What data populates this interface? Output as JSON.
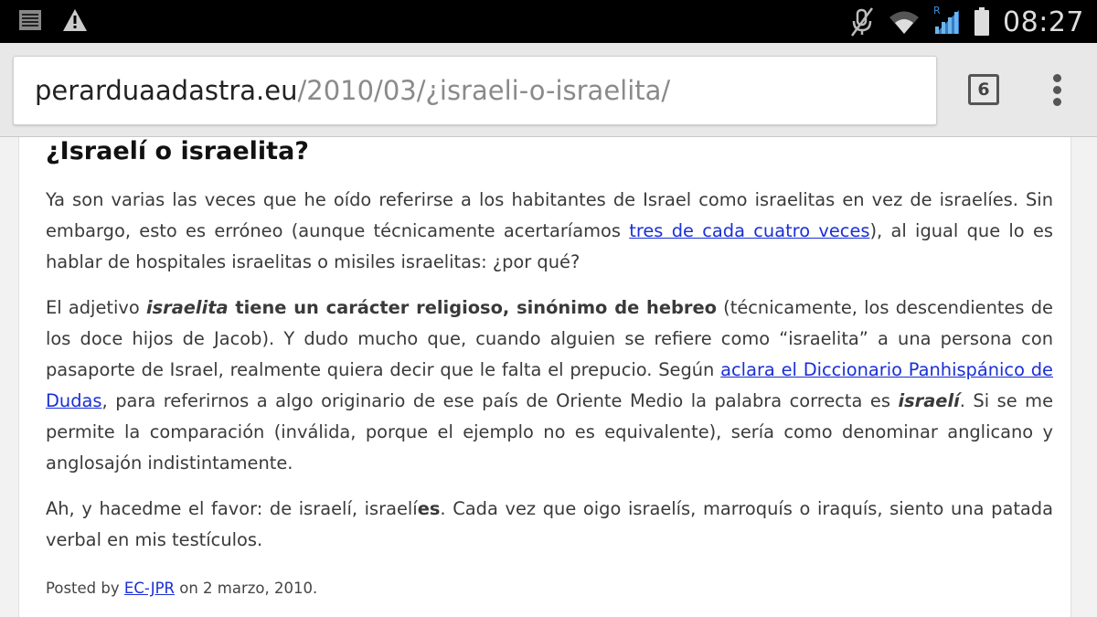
{
  "statusbar": {
    "time": "08:27",
    "icons": [
      "notification-list-icon",
      "warning-icon",
      "mute-icon",
      "wifi-icon",
      "signal-icon",
      "battery-icon"
    ],
    "roaming_letter": "R"
  },
  "address_bar": {
    "host": "perarduaadastra.eu",
    "path": "/2010/03/¿israeli-o-israelita/",
    "tab_count": "6"
  },
  "article": {
    "title": "¿Israelí o israelita?",
    "p1": {
      "t1": "Ya son varias las veces que he oído referirse a los habitantes de Israel como israelitas en vez de israelíes. Sin embargo, esto es erróneo (aunque técnicamente acertaríamos ",
      "link": "tres de cada cuatro veces",
      "t2": "), al igual que lo es hablar de hospitales israelitas o misiles israelitas: ¿por qué?"
    },
    "p2": {
      "t1": "El adjetivo ",
      "em1": "israelita",
      "strong1": " tiene un carácter religioso, sinónimo de hebreo",
      "t2": " (técnicamente, los descendientes de los doce hijos de Jacob). Y dudo mucho que, cuando alguien se refiere como “israelita” a una persona con pasaporte de Israel, realmente quiera decir que le falta el prepucio. Según ",
      "link": "aclara el Diccionario Panhispánico de Dudas",
      "t3": ", para referirnos a algo originario de ese país de Oriente Medio la palabra correcta es ",
      "em2": "israelí",
      "t4": ". Si se me permite la comparación (inválida, porque el ejemplo no es equivalente), sería como denominar anglicano y anglosajón indistintamente."
    },
    "p3": {
      "t1": "Ah, y hacedme el favor: de israelí, israelí",
      "strong1": "es",
      "t2": ". Cada vez que oigo israelís, marroquís o iraquís, siento una patada verbal en mis testículos."
    },
    "meta": {
      "posted_by": "Posted by ",
      "author": "EC-JPR",
      "on": " on 2 marzo, 2010."
    }
  }
}
